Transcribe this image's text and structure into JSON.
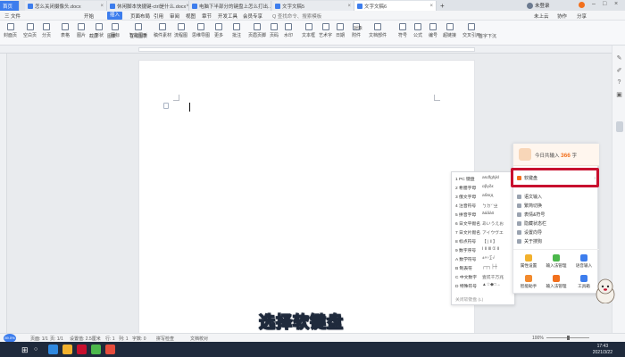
{
  "tabs": [
    {
      "label": "首页",
      "type": "home"
    },
    {
      "label": "怎么关闭摄像头.docx"
    },
    {
      "label": "休闲脚本快捷键-ctrl是什么.docx"
    },
    {
      "label": "电脑下半部分的键盘上怎么打出..."
    },
    {
      "label": "文字文稿5"
    },
    {
      "label": "文字文稿6",
      "active": true
    }
  ],
  "titlebar": {
    "user": "未登录",
    "share": "分享",
    "menu": "...",
    "add_tab": "+"
  },
  "menu": {
    "file": "三 文件",
    "items": [
      "开始",
      "插入",
      "页面布局",
      "引用",
      "审阅",
      "视图",
      "章节",
      "开发工具",
      "会员专享"
    ],
    "active_index": 1,
    "search": "Q 查找命令、搜索模板",
    "right": [
      "未上云",
      "协作",
      "分享"
    ]
  },
  "toolbar": {
    "tools": [
      "封面页",
      "空白页",
      "分页",
      "表格",
      "图片",
      "形状",
      "图标",
      "智能图形",
      "稿件素材",
      "流程图",
      "思维导图",
      "更多",
      "批注",
      "页眉页脚",
      "页码",
      "水印",
      "文本框",
      "艺术字",
      "日期",
      "附件",
      "文档部件",
      "符号",
      "公式",
      "编号",
      "超链接",
      "交叉引用"
    ],
    "sub": [
      "截屏",
      "图表",
      "在线图表",
      "首字下沉",
      "对象"
    ]
  },
  "ime_panel": {
    "today_prefix": "今日共输入",
    "today_count": "366",
    "today_suffix": "字",
    "soft_keyboard": "软键盘",
    "items": [
      "语文输入",
      "繁简切换",
      "表情&符号",
      "隐藏状态栏",
      "设置向导",
      "关于搜狗"
    ],
    "grid": [
      "属性设置",
      "输入法管理",
      "语音输入",
      "智能助手",
      "输入法管理",
      "工具箱"
    ]
  },
  "soft_keyboard_list": [
    {
      "index": "1",
      "name": "PC 键盘",
      "sample": "asdfghjkl"
    },
    {
      "index": "2",
      "name": "希腊字母",
      "sample": "αβγδε"
    },
    {
      "index": "3",
      "name": "俄文字母",
      "sample": "абвгд"
    },
    {
      "index": "4",
      "name": "注音符号",
      "sample": "ㄅㄉˇˋㄓ"
    },
    {
      "index": "5",
      "name": "拼音字母",
      "sample": "āáǎàō"
    },
    {
      "index": "6",
      "name": "日文平假名",
      "sample": "あいうえお"
    },
    {
      "index": "7",
      "name": "日文片假名",
      "sample": "アイウヴエ"
    },
    {
      "index": "8",
      "name": "标点符号",
      "sample": "【 | ‖ 】"
    },
    {
      "index": "9",
      "name": "数字序号",
      "sample": "Ⅰ Ⅱ Ⅲ ① Ⅱ"
    },
    {
      "index": "A",
      "name": "数学符号",
      "sample": "±×÷∑√"
    },
    {
      "index": "B",
      "name": "制表符",
      "sample": "┌┬┐├┼"
    },
    {
      "index": "C",
      "name": "中文数字",
      "sample": "壹贰千万兆"
    },
    {
      "index": "D",
      "name": "特殊符号",
      "sample": "▲☆◆□→"
    },
    {
      "index": "",
      "name": "关闭软键盘 (L)",
      "sample": ""
    }
  ],
  "statusbar": {
    "page": "页面: 1/1",
    "pages": "页: 1/1",
    "settings": "设置值: 2.5厘米",
    "row": "行: 1",
    "col": "列: 1",
    "wordcount": "字数: 0",
    "spellcheck": "拼写检查",
    "docverify": "文档校对",
    "zoom": "100%"
  },
  "taskbar": {
    "time": "17:43",
    "date": "2021/3/22",
    "start_badge": "89.0%"
  },
  "caption": "选择软键盘",
  "colors": {
    "accent": "#3d7ded",
    "highlight": "#c8102e",
    "count": "#f2701d"
  }
}
